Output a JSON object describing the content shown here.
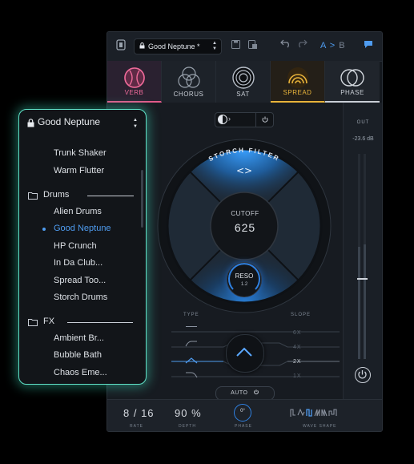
{
  "toolbar": {
    "preset_name": "Good Neptune *",
    "ab_a": "A",
    "ab_sep": ">",
    "ab_b": "B"
  },
  "tabs": [
    {
      "label": "VERB",
      "icon": "verb-icon",
      "active": true
    },
    {
      "label": "CHORUS",
      "icon": "chorus-icon"
    },
    {
      "label": "SAT",
      "icon": "sat-icon"
    },
    {
      "label": "SPREAD",
      "icon": "spread-icon"
    },
    {
      "label": "PHASE",
      "icon": "phase-icon"
    }
  ],
  "filter": {
    "ring_label": "STORCH FILTER",
    "cutoff_label": "CUTOFF",
    "cutoff_value": "625",
    "reso_label": "RESO",
    "reso_value": "1.2",
    "auto_label": "AUTO"
  },
  "type_label": "TYPE",
  "slope_label": "SLOPE",
  "slopes": [
    "6X",
    "4X",
    "2X",
    "1X"
  ],
  "selected_slope": "2X",
  "output": {
    "label": "OUT",
    "value": "-23.6 dB"
  },
  "bottom": {
    "rate_value": "8 / 16",
    "rate_label": "RATE",
    "depth_value": "90 %",
    "depth_label": "DEPTH",
    "phase_value": "0°",
    "phase_label": "PHASE",
    "wave_label": "WAVE SHAPE"
  },
  "dropdown": {
    "header": "Good Neptune",
    "items_top": [
      "Trunk Shaker",
      "Warm Flutter"
    ],
    "cat_drums": "Drums",
    "drums": [
      "Alien Drums",
      "Good Neptune",
      "HP Crunch",
      "In Da Club...",
      "Spread Too...",
      "Storch Drums"
    ],
    "selected": "Good Neptune",
    "cat_fx": "FX",
    "fx": [
      "Ambient Br...",
      "Bubble Bath",
      "Chaos Eme..."
    ]
  },
  "colors": {
    "accent_blue": "#4f9cf0",
    "verb_pink": "#e35a8a",
    "spread_gold": "#e8b33a",
    "glow_teal": "#5fe0c6"
  }
}
